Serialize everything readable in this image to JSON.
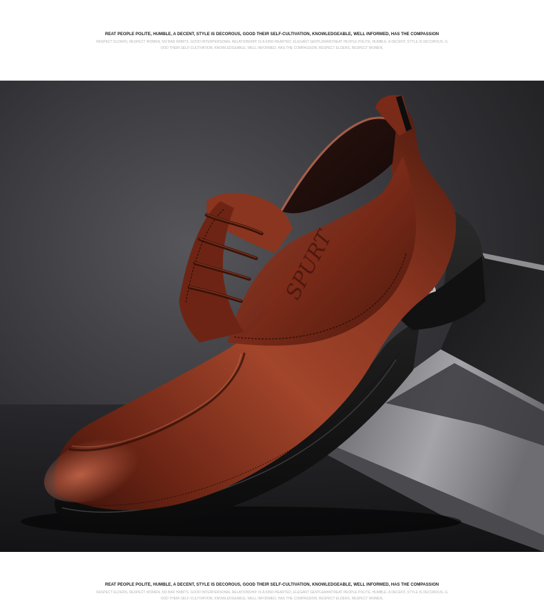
{
  "top_slogan": {
    "title": "REAT PEOPLE POLITE, HUMBLE, A DECENT, STYLE IS DECOROUS, GOOD THEIR SELF-CULTIVATION, KNOWLEDGEABLE, WELL INFORMED, HAS THE COMPASSION",
    "line1": "RESPECT ELDERS, RESPECT WOMEN, NO BAD HABITS. GOOD INTERPERSONAL RELATIONSHIP. IS A KIND-HEARTED, ELEGANT GENTLEMANTREAT PEOPLE POLITE, HUMBLE, A DECENT, STYLE IS DECOROUS, G",
    "line2": "OOD THEIR SELF-CULTIVATION, KNOWLEDGEABLE, WELL INFORMED, HAS THE COMPASSION, RESPECT ELDERS, RESPECT WOMEN,"
  },
  "bottom_slogan": {
    "title": "REAT PEOPLE POLITE, HUMBLE, A DECENT, STYLE IS DECOROUS, GOOD THEIR SELF-CULTIVATION, KNOWLEDGEABLE, WELL INFORMED, HAS THE COMPASSION",
    "line1": "RESPECT ELDERS, RESPECT WOMEN, NO BAD HABITS. GOOD INTERPERSONAL RELATIONSHIP. IS A KIND-HEARTED, ELEGANT GENTLEMANTREAT PEOPLE POLITE, HUMBLE, A DECENT, STYLE IS DECOROUS, G",
    "line2": "OOD THEIR SELF-CULTIVATION, KNOWLEDGEABLE, WELL INFORMED, HAS THE COMPASSION, RESPECT ELDERS, RESPECT WOMEN,"
  },
  "product_photo": {
    "embossed_logo": "SPURT",
    "colors": {
      "background_dark": "#232326",
      "background_light": "#55555a",
      "leather_main": "#7a2a18",
      "leather_highlight": "#b4533a",
      "leather_shadow": "#3a120a",
      "sole": "#121212",
      "laptop_silver": "#9a9a9e"
    }
  }
}
